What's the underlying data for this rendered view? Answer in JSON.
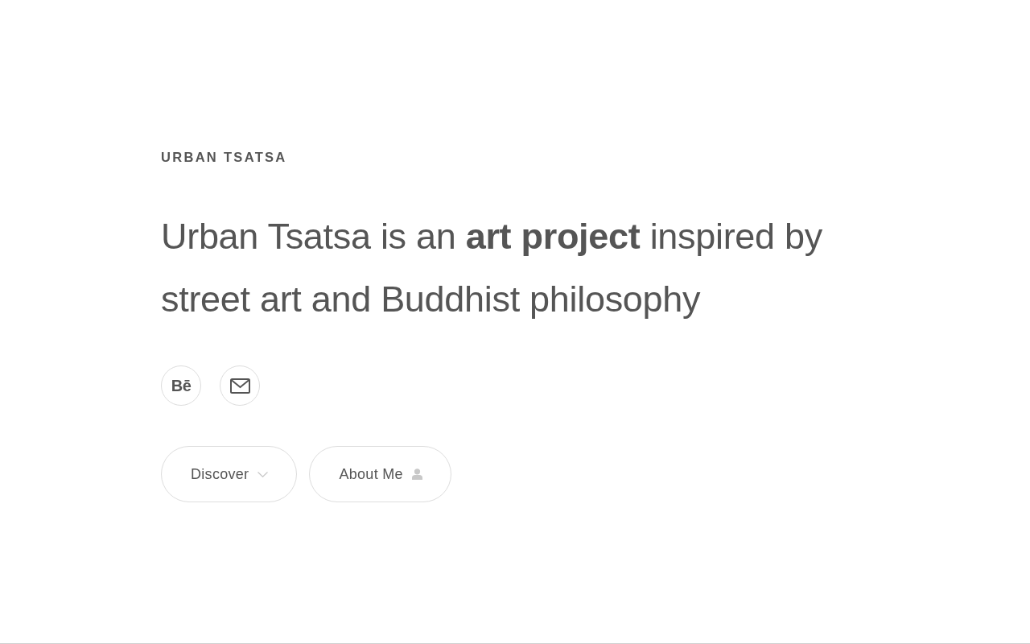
{
  "brand": {
    "title": "URBAN TSATSA"
  },
  "headline": {
    "text": "Urban Tsatsa is an **art project** inspired by street art and Buddhist philosophy"
  },
  "social_links": [
    {
      "kind": "glyph",
      "glyph": "Bē"
    },
    {
      "kind": "mail"
    }
  ],
  "buttons": [
    {
      "label": "Discover",
      "kind": "chevron"
    },
    {
      "label": "About Me",
      "kind": "person"
    }
  ]
}
